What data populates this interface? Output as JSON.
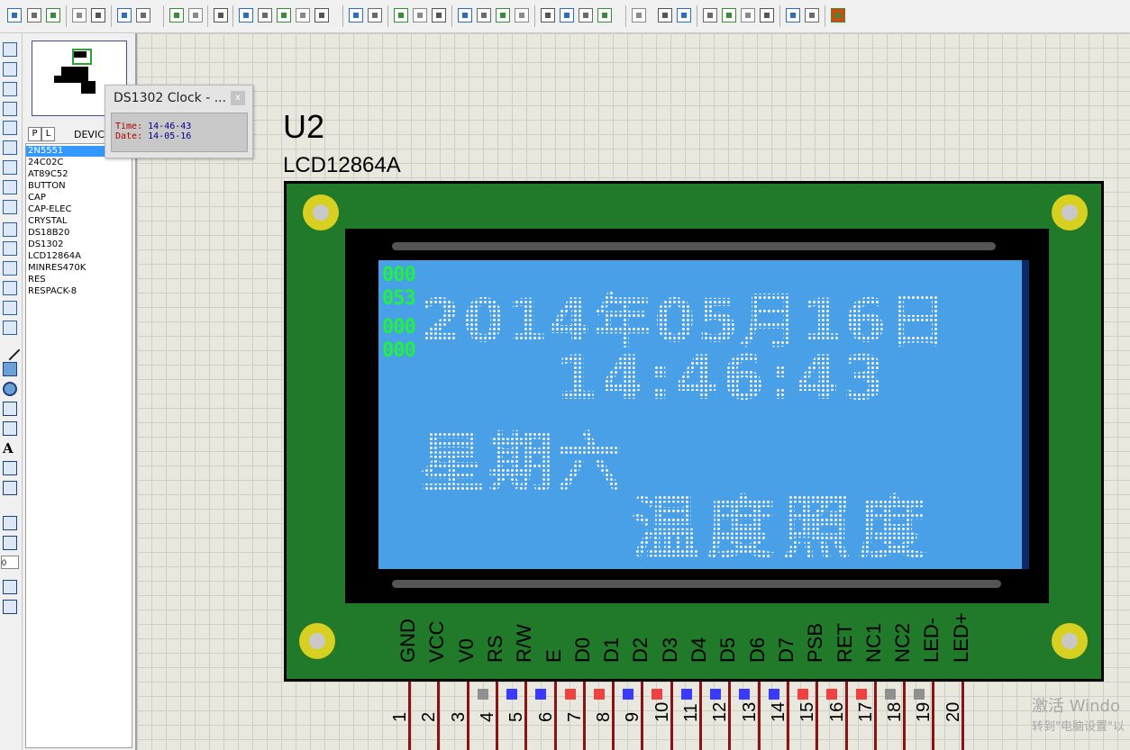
{
  "toolbar": {
    "icons": [
      "new-file",
      "open-file",
      "save",
      "import",
      "export",
      "print",
      "print-area",
      "refresh",
      "grid",
      "origin",
      "pan",
      "zoom-in",
      "zoom-out",
      "zoom-all",
      "zoom-area",
      "undo",
      "redo",
      "cut",
      "copy",
      "paste",
      "block-copy",
      "block-move",
      "block-rotate",
      "block-delete",
      "pick-device",
      "make-device",
      "packaging",
      "decompose",
      "wire-autorouter",
      "search-tag",
      "property-assignment",
      "design-explorer",
      "new-sheet",
      "remove-sheet",
      "exit-to-parent",
      "bill-of-materials",
      "electrical-rule-check",
      "netlist-to-ares"
    ]
  },
  "left_tools": [
    "selection",
    "component",
    "junction",
    "wire-label",
    "text-script",
    "bus",
    "subcircuit",
    "terminals",
    "device-pins",
    "graph",
    "tape-recorder",
    "generator",
    "voltage-probe",
    "current-probe",
    "virtual-instruments",
    "line",
    "box",
    "circle",
    "arc",
    "path",
    "text",
    "symbol",
    "marker",
    "rotate-cw",
    "rotate-ccw",
    "flip-horizontal",
    "flip-vertical"
  ],
  "rotation_value": "0",
  "device_panel": {
    "tab_p": "P",
    "tab_l": "L",
    "header": "DEVIC",
    "devices": [
      "2N5551",
      "24C02C",
      "AT89C52",
      "BUTTON",
      "CAP",
      "CAP-ELEC",
      "CRYSTAL",
      "DS18B20",
      "DS1302",
      "LCD12864A",
      "MINRES470K",
      "RES",
      "RESPACK-8"
    ],
    "selected_index": 0
  },
  "popup": {
    "title": "DS1302 Clock - ...",
    "close": "x",
    "time_label": "Time:",
    "time_value": "14-46-43",
    "date_label": "Date:",
    "date_value": "14-05-16"
  },
  "component": {
    "reference": "U2",
    "model": "LCD12864A"
  },
  "lcd": {
    "debug_lines": [
      "000",
      "053",
      "000",
      "000"
    ],
    "row1": "2014年05月16日",
    "row2": "14:46:43",
    "row3": "星期六",
    "row4": "温度照度"
  },
  "pins": {
    "labels": [
      "GND",
      "VCC",
      "V0",
      "RS",
      "R/W",
      "E",
      "D0",
      "D1",
      "D2",
      "D3",
      "D4",
      "D5",
      "D6",
      "D7",
      "PSB",
      "RET",
      "NC1",
      "NC2",
      "LED-",
      "LED+"
    ],
    "numbers": [
      "1",
      "2",
      "3",
      "4",
      "5",
      "6",
      "7",
      "8",
      "9",
      "10",
      "11",
      "12",
      "13",
      "14",
      "15",
      "16",
      "17",
      "18",
      "19",
      "20"
    ],
    "states": [
      "none",
      "none",
      "gray",
      "blue",
      "blue",
      "red",
      "red",
      "blue",
      "red",
      "blue",
      "blue",
      "blue",
      "blue",
      "red",
      "red",
      "red",
      "gray",
      "gray",
      "none",
      "none"
    ],
    "colors": {
      "red": "#f04040",
      "blue": "#3a3aff",
      "gray": "#909090"
    }
  },
  "watermark": {
    "line1": "激活 Windo",
    "line2": "转到\"电脑设置\"以"
  }
}
